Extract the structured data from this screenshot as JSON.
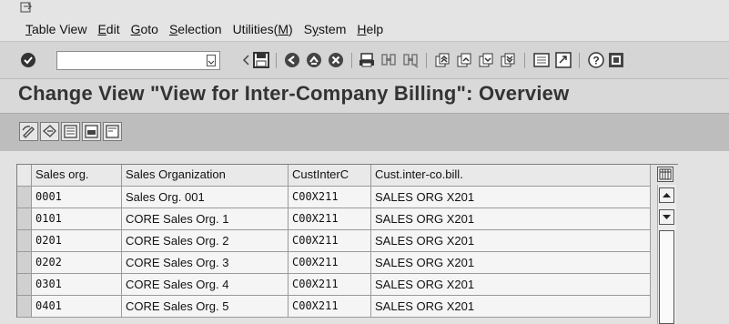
{
  "menu": {
    "items": [
      {
        "label": "Table View",
        "mnemonic_index": 0
      },
      {
        "label": "Edit",
        "mnemonic_index": 0
      },
      {
        "label": "Goto",
        "mnemonic_index": 0
      },
      {
        "label": "Selection",
        "mnemonic_index": 0
      },
      {
        "label": "Utilities(M)",
        "mnemonic_index": 10
      },
      {
        "label": "System",
        "mnemonic_index": 1
      },
      {
        "label": "Help",
        "mnemonic_index": 0
      }
    ]
  },
  "toolbar": {
    "command_field": {
      "value": "",
      "placeholder": ""
    },
    "icons": [
      "enter-icon",
      "save-icon",
      "back-icon",
      "exit-icon",
      "cancel-icon",
      "print-icon",
      "find-icon",
      "find-next-icon",
      "first-page-icon",
      "previous-page-icon",
      "next-page-icon",
      "last-page-icon",
      "create-session-icon",
      "shortcut-icon",
      "help-icon",
      "layout-menu-icon"
    ]
  },
  "page": {
    "title": "Change View \"View for Inter-Company Billing\": Overview"
  },
  "app_toolbar": {
    "icons": [
      "display-change-icon",
      "other-entry-icon",
      "select-all-icon",
      "select-block-icon",
      "deselect-all-icon"
    ]
  },
  "table": {
    "columns": [
      "Sales org.",
      "Sales Organization",
      "CustInterC",
      "Cust.inter-co.bill."
    ],
    "rows": [
      [
        "0001",
        "Sales Org. 001",
        "C00X211",
        "SALES ORG X201"
      ],
      [
        "0101",
        "CORE Sales Org. 1",
        "C00X211",
        "SALES ORG X201"
      ],
      [
        "0201",
        "CORE Sales Org. 2",
        "C00X211",
        "SALES ORG X201"
      ],
      [
        "0202",
        "CORE Sales Org. 3",
        "C00X211",
        "SALES ORG X201"
      ],
      [
        "0301",
        "CORE Sales Org. 4",
        "C00X211",
        "SALES ORG X201"
      ],
      [
        "0401",
        "CORE Sales Org. 5",
        "C00X211",
        "SALES ORG X201"
      ]
    ]
  },
  "colors": {
    "background": "#d9d9d9",
    "title_text": "#333333",
    "app_toolbar": "#bdbdbd",
    "cell_background": "#f5f5f5"
  }
}
